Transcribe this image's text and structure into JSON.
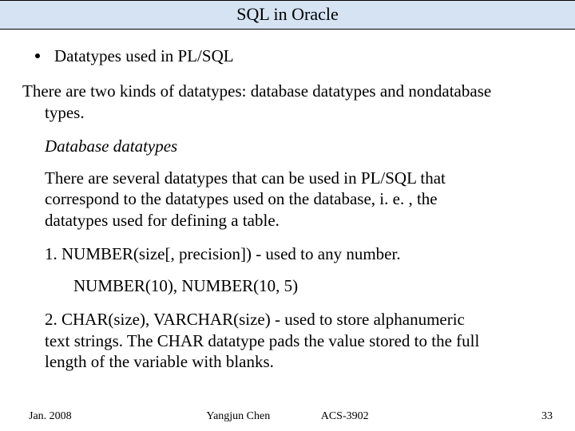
{
  "title": "SQL in Oracle",
  "bullet": "Datatypes used in PL/SQL",
  "intro_l1": "There are two kinds of datatypes: database datatypes and nondatabase",
  "intro_l2": "types.",
  "subhead": "Database datatypes",
  "para_l1": "There are several datatypes that can be used in PL/SQL that",
  "para_l2": "correspond to the datatypes used on the database, i. e. , the",
  "para_l3": "datatypes used for defining a table.",
  "num1": "1. NUMBER(size[, precision]) - used to any number.",
  "example": "NUMBER(10), NUMBER(10, 5)",
  "num2_l1": "2. CHAR(size), VARCHAR(size) - used to store alphanumeric",
  "num2_l2": "text strings. The CHAR datatype pads the value stored to the full",
  "num2_l3": "length of the variable with blanks.",
  "footer": {
    "date": "Jan. 2008",
    "author": "Yangjun Chen",
    "course": "ACS-3902",
    "page": "33"
  }
}
